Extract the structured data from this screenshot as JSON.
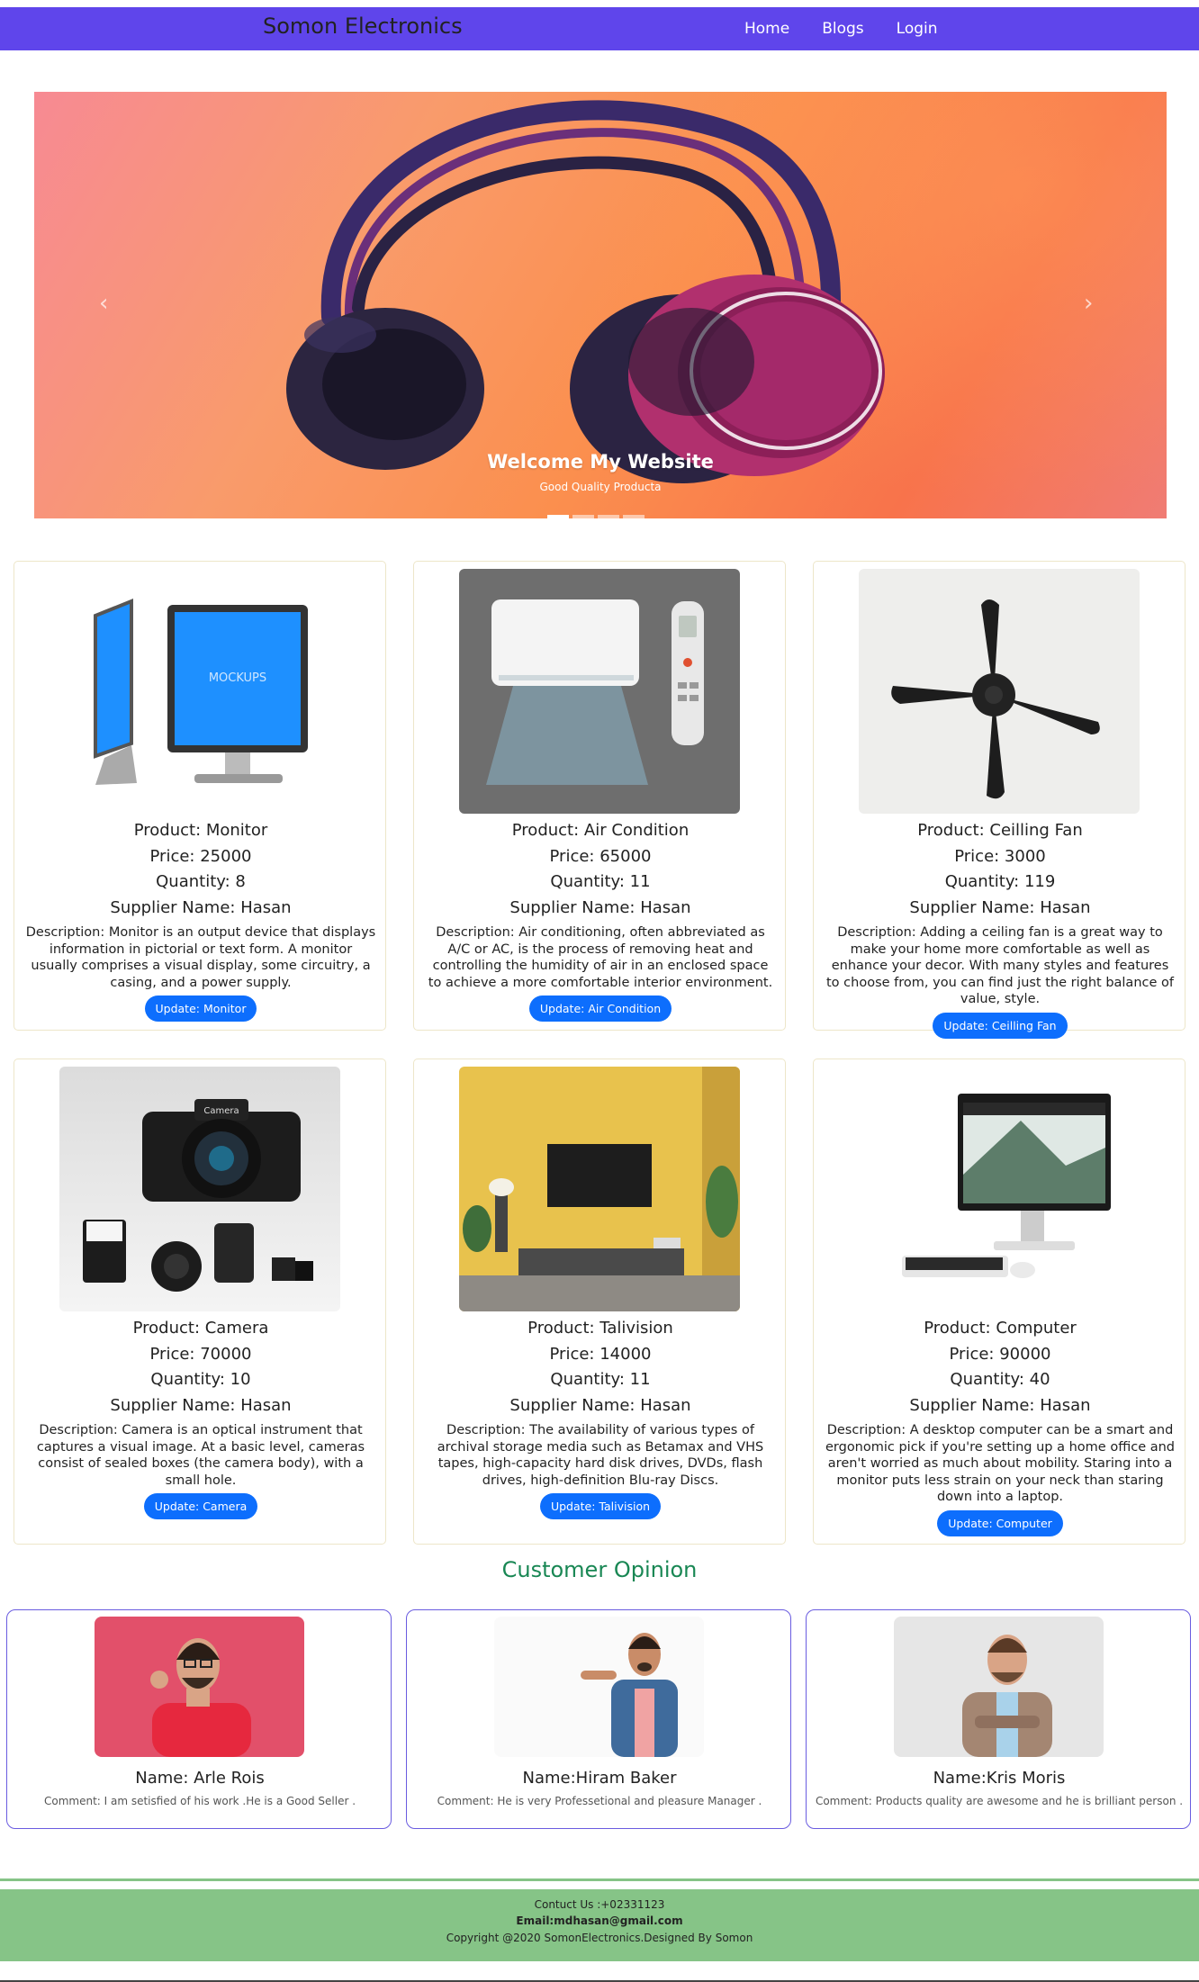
{
  "nav": {
    "brand": "Somon Electronics",
    "links": [
      "Home",
      "Blogs",
      "Login"
    ]
  },
  "hero": {
    "title": "Welcome My Website",
    "subtitle": "Good Quality Producta",
    "prev_icon": "chevron-left-icon",
    "next_icon": "chevron-right-icon",
    "slides": 4,
    "active_slide": 1
  },
  "products": [
    {
      "product": "Product: Monitor",
      "price": "Price: 25000",
      "quantity": "Quantity: 8",
      "supplier": "Supplier Name: Hasan",
      "description": "Description: Monitor is an output device that displays information in pictorial or text form. A monitor usually comprises a visual display, some circuitry, a casing, and a power supply.",
      "button": "Update: Monitor",
      "image_label": "MOCKUPS"
    },
    {
      "product": "Product: Air Condition",
      "price": "Price: 65000",
      "quantity": "Quantity: 11",
      "supplier": "Supplier Name: Hasan",
      "description": "Description: Air conditioning, often abbreviated as A/C or AC, is the process of removing heat and controlling the humidity of air in an enclosed space to achieve a more comfortable interior environment.",
      "button": "Update: Air Condition"
    },
    {
      "product": "Product: Ceilling Fan",
      "price": "Price: 3000",
      "quantity": "Quantity: 119",
      "supplier": "Supplier Name: Hasan",
      "description": "Description: Adding a ceiling fan is a great way to make your home more comfortable as well as enhance your decor. With many styles and features to choose from, you can find just the right balance of value, style.",
      "button": "Update: Ceilling Fan"
    },
    {
      "product": "Product: Camera",
      "price": "Price: 70000",
      "quantity": "Quantity: 10",
      "supplier": "Supplier Name: Hasan",
      "description": "Description: Camera is an optical instrument that captures a visual image. At a basic level, cameras consist of sealed boxes (the camera body), with a small hole.",
      "button": "Update: Camera",
      "image_label": "Camera"
    },
    {
      "product": "Product: Talivision",
      "price": "Price: 14000",
      "quantity": "Quantity: 11",
      "supplier": "Supplier Name: Hasan",
      "description": "Description: The availability of various types of archival storage media such as Betamax and VHS tapes, high-capacity hard disk drives, DVDs, flash drives, high-definition Blu-ray Discs.",
      "button": "Update: Talivision"
    },
    {
      "product": "Product: Computer",
      "price": "Price: 90000",
      "quantity": "Quantity: 40",
      "supplier": "Supplier Name: Hasan",
      "description": "Description: A desktop computer can be a smart and ergonomic pick if you're setting up a home office and aren't worried as much about mobility. Staring into a monitor puts less strain on your neck than staring down into a laptop.",
      "button": "Update: Computer"
    }
  ],
  "opinion": {
    "title": "Customer Opinion",
    "reviews": [
      {
        "name": "Name: Arle Rois",
        "comment": "Comment: I am setisfied of his work .He is a Good Seller ."
      },
      {
        "name": "Name:Hiram Baker",
        "comment": "Comment: He is very Professetional and pleasure Manager ."
      },
      {
        "name": "Name:Kris Moris",
        "comment": "Comment: Products quality are awesome and he is brilliant person ."
      }
    ]
  },
  "footer": {
    "contact": "Contuct Us :+02331123",
    "email": "Email:mdhasan@gmail.com",
    "copyright": "Copyright @2020 SomonElectronics.Designed By Somon"
  },
  "colors": {
    "navbar": "#5f45eb",
    "button": "#0d6efd",
    "opinion_title": "#198754",
    "footer": "#86c487",
    "review_border": "#6a5ce0"
  }
}
